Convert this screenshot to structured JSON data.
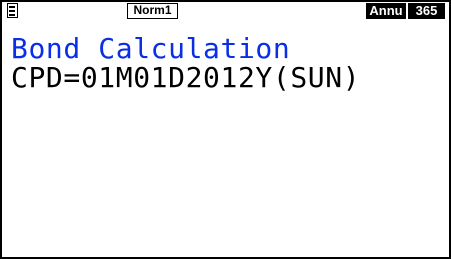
{
  "status_bar": {
    "mode_label": "Norm1",
    "day_count_basis": "Annu",
    "day_count_days": "365",
    "battery_icon": "battery-icon"
  },
  "display": {
    "title": "Bond Calculation",
    "cpd_line": "CPD=01M01D2012Y(SUN)"
  },
  "colors": {
    "title_text": "#0a2ee6",
    "body_text": "#000000",
    "background": "#ffffff"
  }
}
